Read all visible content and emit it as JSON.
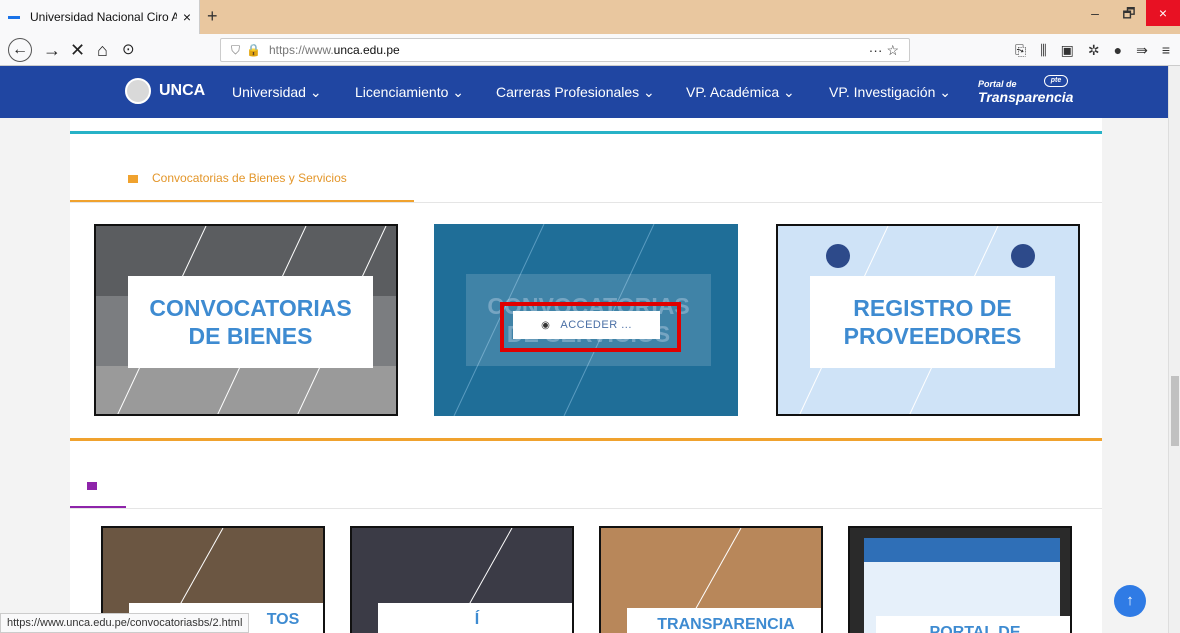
{
  "browser": {
    "tab_title": "Universidad Nacional Ciro Aleg",
    "tab_close": "×",
    "new_tab": "+",
    "url_prefix": "https://www.",
    "url_domain": "unca.edu.pe",
    "url_actions": "··· ☆",
    "window": {
      "minimize": "–",
      "restore": "🗗",
      "close": "×"
    },
    "nav": {
      "back": "←",
      "forward": "→",
      "stop": "✕",
      "home": "⌂",
      "history": "⊙"
    },
    "toolbar_icons": [
      "⎘",
      "⫼",
      "▣",
      "✲",
      "●",
      "⇛",
      "≡"
    ],
    "status_url": "https://www.unca.edu.pe/convocatoriasbs/2.html"
  },
  "site_nav": {
    "brand": "UNCA",
    "items": [
      {
        "label": "Universidad ⌄"
      },
      {
        "label": "Licenciamiento ⌄"
      },
      {
        "label": "Carreras Profesionales ⌄"
      },
      {
        "label": "VP. Académica ⌄"
      },
      {
        "label": "VP. Investigación ⌄"
      }
    ],
    "portal": {
      "line1": "Portal de",
      "line2": "Transparencia",
      "badge": "pte"
    }
  },
  "section1": {
    "tab_label": "Convocatorias de Bienes y Servicios",
    "tiles": [
      {
        "title_line1": "CONVOCATORIAS",
        "title_line2": "DE BIENES"
      },
      {
        "title_line1": "CONVOCATORIAS",
        "title_line2": "DE SERVICIOS"
      },
      {
        "title_line1": "REGISTRO DE",
        "title_line2": "PROVEEDORES"
      }
    ],
    "hover_button": "ACCEDER ...",
    "hover_icon": "◉"
  },
  "section2": {
    "tiles": [
      {
        "label": "TOS"
      },
      {
        "label": "Í"
      },
      {
        "label": "TRANSPARENCIA"
      },
      {
        "label": "PORTAL DE"
      }
    ]
  },
  "back_to_top": "↑",
  "colors": {
    "nav_blue": "#2046a2",
    "accent_orange": "#f0a22e",
    "accent_teal": "#27b2c7",
    "accent_purple": "#8e24aa",
    "title_blue": "#3e8bd1",
    "highlight_red": "#e00000"
  }
}
